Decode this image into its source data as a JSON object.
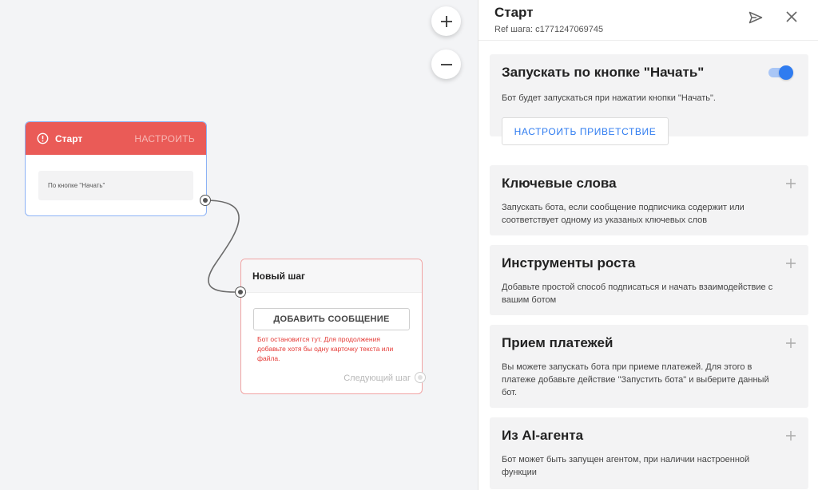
{
  "canvas": {
    "zoom_in_label": "+",
    "zoom_out_label": "−",
    "start_node": {
      "title": "Старт",
      "configure_label": "НАСТРОИТЬ",
      "trigger_text": "По кнопке \"Начать\""
    },
    "new_node": {
      "title": "Новый шаг",
      "add_message_label": "ДОБАВИТЬ СООБЩЕНИЕ",
      "warning": "Бот остановится тут. Для продолжения добавьте хотя бы одну карточку текста или файла.",
      "next_step_label": "Следующий шаг"
    }
  },
  "panel": {
    "title": "Старт",
    "ref": "Ref шага: c1771247069745",
    "cards": [
      {
        "title": "Запускать по кнопке \"Начать\"",
        "desc": "Бот будет запускаться при нажатии кнопки \"Начать\".",
        "button_label": "НАСТРОИТЬ ПРИВЕТСТВИЕ",
        "toggle_on": true
      },
      {
        "title": "Ключевые слова",
        "desc": "Запускать бота, если сообщение подписчика содержит или соответствует одному из указаных ключевых слов"
      },
      {
        "title": "Инструменты роста",
        "desc": "Добавьте простой способ подписаться и начать взаимодействие с вашим ботом"
      },
      {
        "title": "Прием платежей",
        "desc": "Вы можете запускать бота при приеме платежей. Для этого в платеже добавьте действие \"Запустить бота\" и выберите данный бот."
      },
      {
        "title": "Из AI-агента",
        "desc": "Бот может быть запущен агентом, при наличии настроенной функции"
      }
    ]
  },
  "colors": {
    "start_header": "#ea5b57",
    "accent_blue": "#2f7cf0",
    "warning_red": "#e53935"
  }
}
